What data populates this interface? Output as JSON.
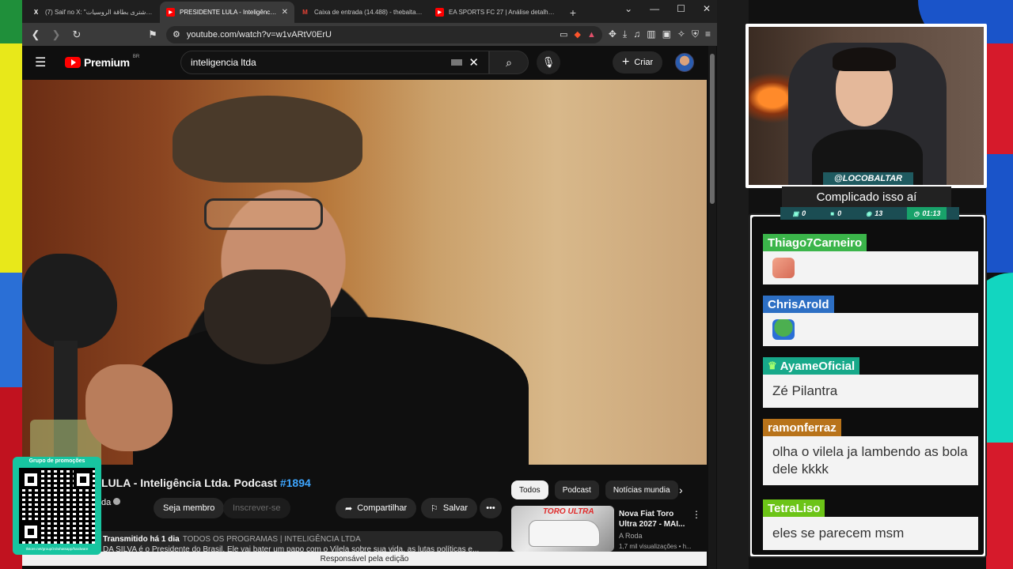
{
  "browser": {
    "tabs": [
      {
        "title": "(7) Saif no X: \"روسي اشترى بطاقة الروسيات",
        "favicon": "X",
        "active": false
      },
      {
        "title": "PRESIDENTE LULA - Inteligência Ltda.",
        "favicon": "▶",
        "active": true
      },
      {
        "title": "Caixa de entrada (14.488) - thebaltar@gm...",
        "favicon": "M",
        "active": false
      },
      {
        "title": "EA SPORTS FC 27 | Análise detalhada da Ca...",
        "favicon": "▶",
        "active": false
      }
    ],
    "url": "youtube.com/watch?v=w1vARtV0ErU"
  },
  "youtube": {
    "logo_word": "Premium",
    "logo_region": "BR",
    "search_value": "inteligencia ltda",
    "create_label": "Criar",
    "video_title_main": "LULA - Inteligência Ltda. Podcast",
    "video_title_hash": "#1894",
    "channel_name": "da",
    "member_label": "Seja membro",
    "subscribe_label": "Inscrever-se",
    "share_label": "Compartilhar",
    "save_label": "Salvar",
    "desc_prefix": "Transmitido há 1 dia",
    "desc_categories": "TODOS OS PROGRAMAS | INTELIGÊNCIA LTDA",
    "desc_line2": "DA SILVA é o Presidente do Brasil. Ele vai bater um papo com o Vilela sobre sua vida, as lutas políticas e...",
    "chips": [
      "Todos",
      "Podcast",
      "Notícias mundia"
    ],
    "rec": {
      "thumb_brand": "TORO ULTRA",
      "title": "Nova Fiat Toro Ultra 2027 - MAI...",
      "channel": "A Roda",
      "meta": "1,7 mil visualizações • h..."
    },
    "status_bar": "Responsável pela edição"
  },
  "qr": {
    "label": "Grupo de promoções",
    "url": "tlstore.net/group/zs/whatsapp/hardware"
  },
  "stream": {
    "streamer": "@LOCOBALTAR",
    "title": "Complicado isso aí",
    "stats": [
      "0",
      "0",
      "13",
      "01:13"
    ]
  },
  "chat": [
    {
      "user": "Thiago7Carneiro",
      "color": "#3bb54a",
      "text": "",
      "emote": "thumb"
    },
    {
      "user": "ChrisArold",
      "color": "#2d6fc4",
      "text": "",
      "emote": "pepe"
    },
    {
      "user": "AyameOficial",
      "color": "#17a98a",
      "text": "Zé Pilantra",
      "badge": true
    },
    {
      "user": "ramonferraz",
      "color": "#b8731a",
      "text": "olha o vilela ja lambendo as bola dele kkkk"
    },
    {
      "user": "TetraLiso",
      "color": "#6cc417",
      "text": "eles se parecem msm"
    }
  ]
}
